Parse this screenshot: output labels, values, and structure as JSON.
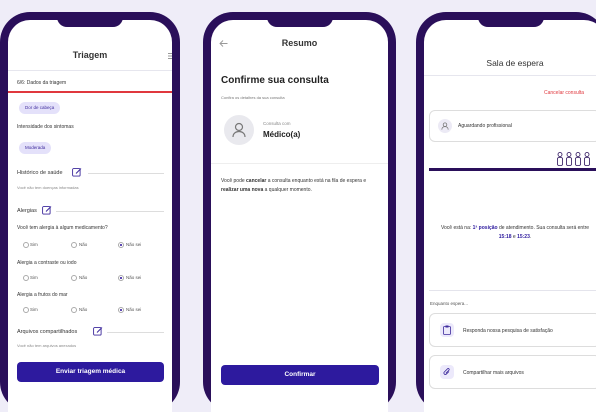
{
  "triage": {
    "title": "Triagem",
    "step": "6/6: Dados da triagem",
    "symptom_chip": "Dor de cabeça",
    "intensity_label": "Intensidade dos sintomas",
    "intensity_chip": "Moderada",
    "health_history": "Histórico de saúde",
    "health_history_note": "Você não tem doenças informadas",
    "allergies": "Alergias",
    "q1": "Você tem alergia à algum medicamento?",
    "q2": "Alergia a contraste ou iodo",
    "q3": "Alergia a frutos do mar",
    "opt_yes": "Sim",
    "opt_no": "Não",
    "opt_unknown": "Não sei",
    "files": "Arquivos compartilhados",
    "files_note": "Você não tem arquivos anexados",
    "submit": "Enviar triagem médica"
  },
  "summary": {
    "title": "Resumo",
    "heading": "Confirme sua consulta",
    "subheading": "Confira os detalhes da sua consulta",
    "consult_label": "Consulta com",
    "doctor": "Médico(a)",
    "note_1": "Você pode ",
    "note_cancel": "cancelar",
    "note_2": " a consulta enquanto está na fila de espera e ",
    "note_redo": "realizar uma nova",
    "note_3": " a qualquer momento.",
    "confirm": "Confirmar"
  },
  "waiting": {
    "title": "Sala de espera",
    "cancel": "Cancelar consulta",
    "waiting_pro": "Aguardando profissional",
    "pos_1": "Você está na: ",
    "pos_strong": "1ª posição",
    "pos_2": " de atendimento. Sua consulta será entre ",
    "time_1": "15:18",
    "pos_3": " e ",
    "time_2": "15:23",
    "pos_4": ".",
    "meanwhile": "Enquanto espera...",
    "survey": "Responda nossa pesquisa de satisfação",
    "share": "Compartilhar mais arquivos"
  },
  "colors": {
    "brand": "#2a0f5a",
    "primary": "#2d1a9e",
    "danger": "#e0383e",
    "chip_bg": "#e4e1fa"
  }
}
